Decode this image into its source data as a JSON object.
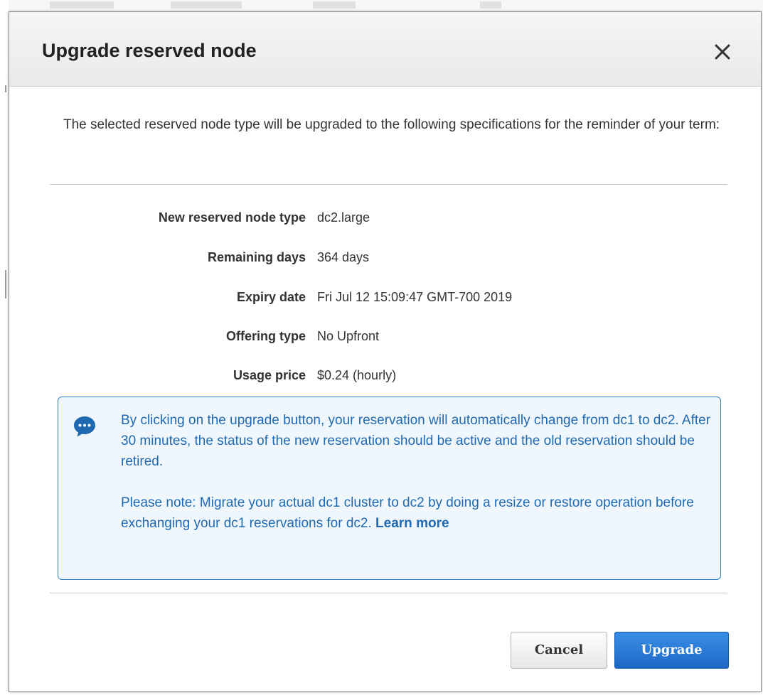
{
  "dialog": {
    "title": "Upgrade reserved node",
    "close_label": "Close",
    "intro": "The selected reserved node type will be upgraded to the following specifications for the reminder of your term:"
  },
  "details": [
    {
      "label": "New reserved node type",
      "value": "dc2.large"
    },
    {
      "label": "Remaining days",
      "value": "364 days"
    },
    {
      "label": "Expiry date",
      "value": "Fri Jul 12 15:09:47 GMT-700 2019"
    },
    {
      "label": "Offering type",
      "value": "No Upfront"
    },
    {
      "label": "Usage price",
      "value": "$0.24 (hourly)"
    }
  ],
  "info": {
    "icon": "chat-bubble-icon",
    "paragraph1": "By clicking on the upgrade button, your reservation will automatically change from dc1 to dc2. After 30 minutes, the status of the new reservation should be active and the old reservation should be retired.",
    "paragraph2": "Please note: Migrate your actual dc1 cluster to dc2 by doing a resize or restore operation before exchanging your dc1 reservations for dc2.",
    "learn_more": "Learn more"
  },
  "buttons": {
    "cancel": "Cancel",
    "upgrade": "Upgrade"
  },
  "colors": {
    "accent": "#1f69b3",
    "info_bg": "#f0f7fc",
    "info_border": "#2f7fc1",
    "primary_button": "#2a7dd9"
  }
}
